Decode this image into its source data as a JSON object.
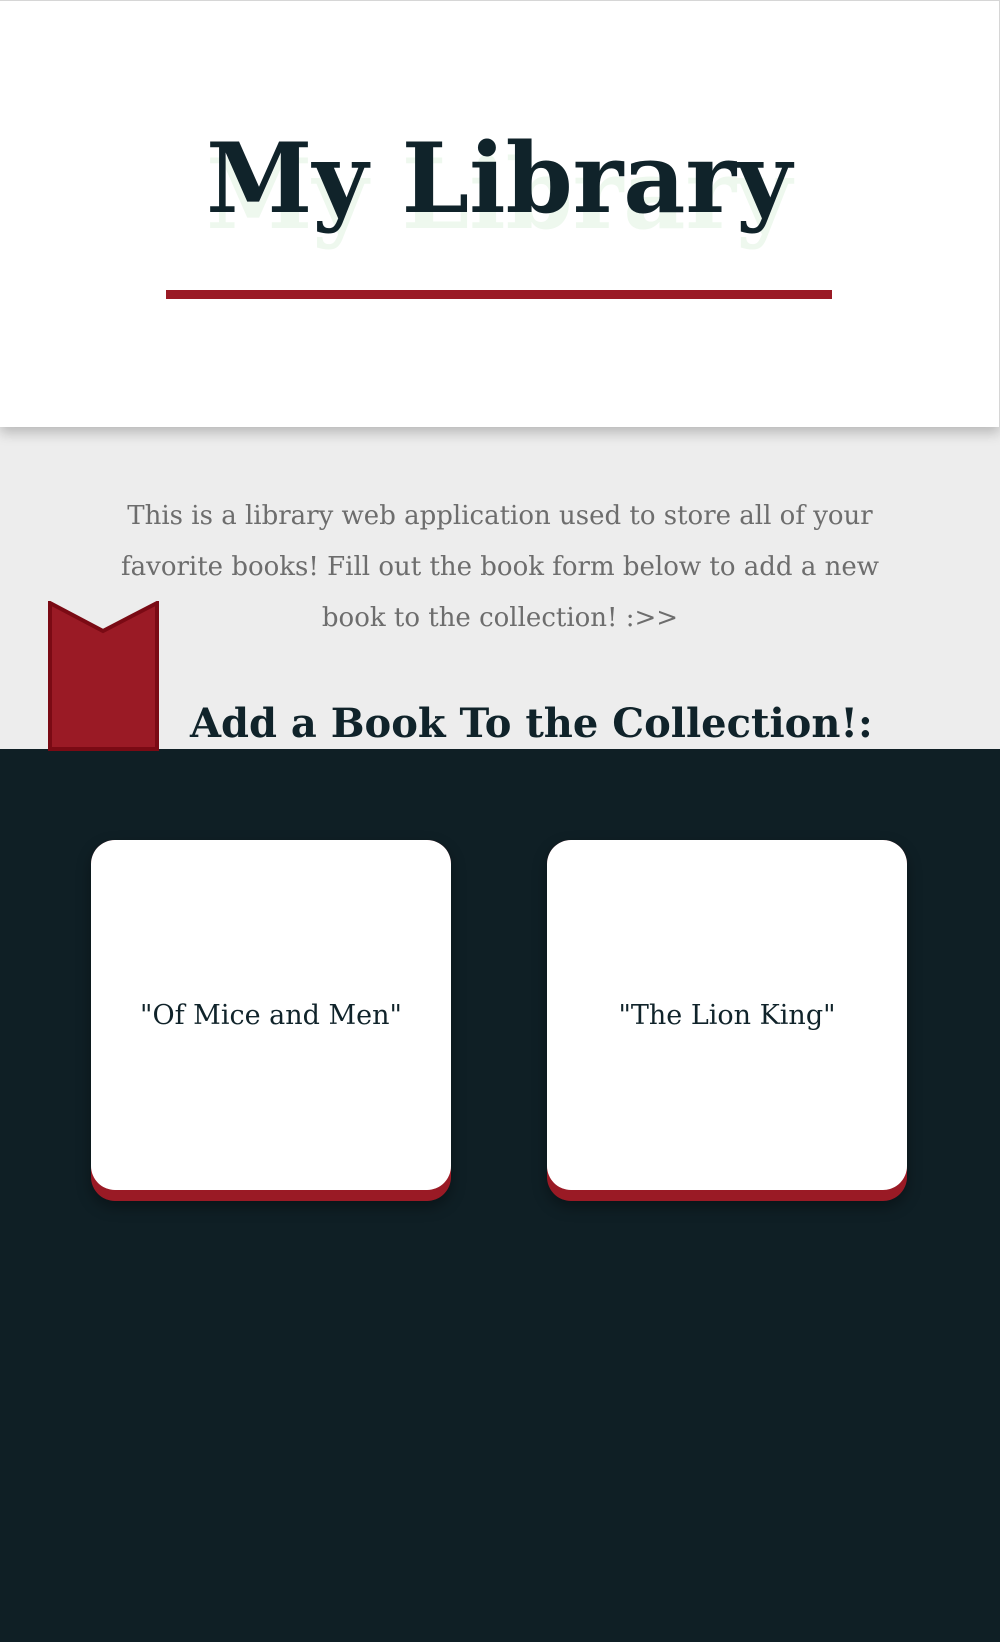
{
  "header": {
    "title": "My Library"
  },
  "intro": {
    "description": "This is a library web application used to store all of your favorite books! Fill out the book form below to add a new book to the collection! :>>",
    "heading": "Add a Book To the Collection!:"
  },
  "books": [
    {
      "title": "\"Of Mice and Men\""
    },
    {
      "title": "\"The Lion King\""
    }
  ],
  "colors": {
    "accent": "#9a1a25",
    "dark": "#0f1f25",
    "intro_bg": "#ededed"
  },
  "icons": {
    "bookmark": "bookmark-icon"
  }
}
